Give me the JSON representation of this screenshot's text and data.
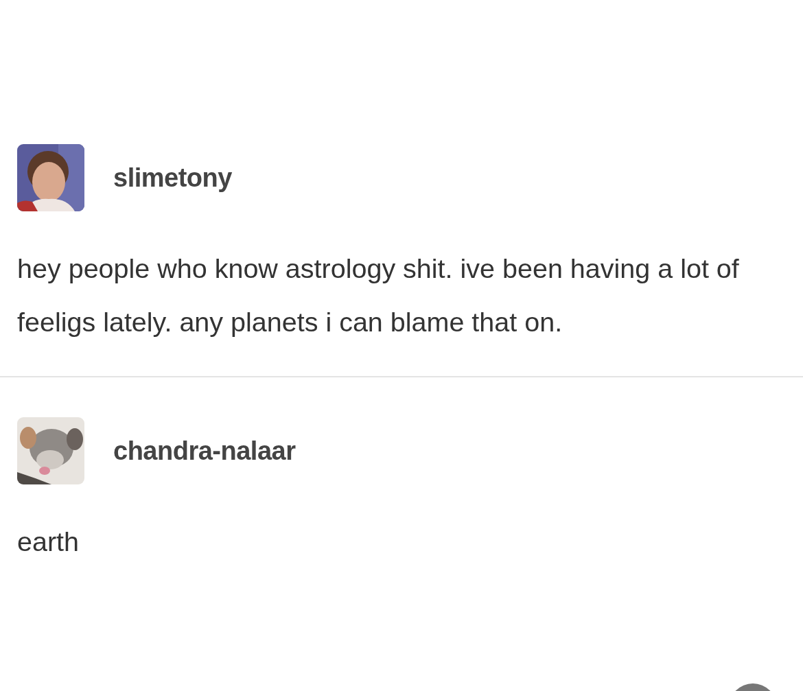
{
  "posts": [
    {
      "username": "slimetony",
      "text": "hey people who know astrology shit. ive been having a lot of feeligs lately. any planets i can blame that on."
    },
    {
      "username": "chandra-nalaar",
      "text": "earth"
    }
  ]
}
